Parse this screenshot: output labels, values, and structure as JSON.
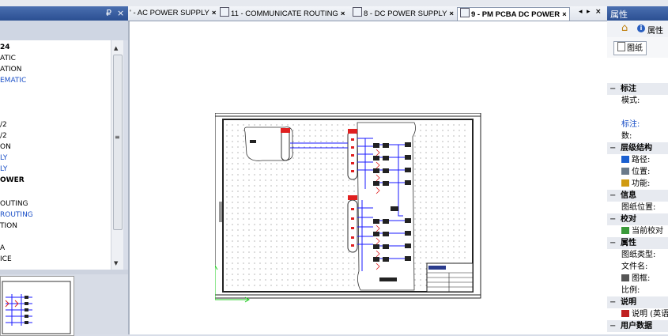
{
  "left_panel": {
    "pin": "₽",
    "close": "×",
    "tree_items": [
      {
        "text": "24",
        "style": "bold"
      },
      {
        "text": "ATIC",
        "style": "normal"
      },
      {
        "text": "ATION",
        "style": "normal"
      },
      {
        "text": "EMATIC",
        "style": "blue"
      },
      {
        "text": "/2",
        "style": "normal"
      },
      {
        "text": "/2",
        "style": "normal"
      },
      {
        "text": "ON",
        "style": "normal"
      },
      {
        "text": "LY",
        "style": "blue"
      },
      {
        "text": "LY",
        "style": "blue"
      },
      {
        "text": "OWER",
        "style": "bold"
      },
      {
        "text": "OUTING",
        "style": "normal"
      },
      {
        "text": " ROUTING",
        "style": "blue"
      },
      {
        "text": "TION",
        "style": "normal"
      },
      {
        "text": "A",
        "style": "normal"
      },
      {
        "text": "ICE",
        "style": "normal"
      }
    ]
  },
  "tabs": [
    {
      "label": "' - AC POWER SUPPLY",
      "icon": false,
      "active": false
    },
    {
      "label": "11 - COMMUNICATE ROUTING",
      "icon": true,
      "active": false
    },
    {
      "label": "8 - DC POWER SUPPLY",
      "icon": true,
      "active": false
    },
    {
      "label": "9 - PM PCBA DC POWER",
      "icon": true,
      "active": true
    }
  ],
  "tab_close": "×",
  "tab_nav": {
    "prev": "◂",
    "next": "▸",
    "close": "×"
  },
  "right_panel": {
    "title": "属性",
    "toolbar_label": "属性",
    "paper_tab": "图纸",
    "props": [
      {
        "type": "cat",
        "text": "标注"
      },
      {
        "type": "prop",
        "text": "模式:"
      },
      {
        "type": "blank"
      },
      {
        "type": "prop",
        "text": "标注:",
        "color": "blue"
      },
      {
        "type": "prop",
        "text": "数:"
      },
      {
        "type": "cat",
        "text": "层级结构"
      },
      {
        "type": "prop",
        "text": "路径:",
        "icon": "path-icon"
      },
      {
        "type": "prop",
        "text": "位置:",
        "icon": "location-icon"
      },
      {
        "type": "prop",
        "text": "功能:",
        "icon": "function-icon"
      },
      {
        "type": "cat",
        "text": "信息"
      },
      {
        "type": "prop",
        "text": "图纸位置:"
      },
      {
        "type": "cat",
        "text": "校对"
      },
      {
        "type": "prop",
        "text": "当前校对",
        "icon": "check-icon"
      },
      {
        "type": "cat",
        "text": "属性"
      },
      {
        "type": "prop",
        "text": "图纸类型:"
      },
      {
        "type": "prop",
        "text": "文件名:"
      },
      {
        "type": "prop",
        "text": "图框:",
        "icon": "frame-icon"
      },
      {
        "type": "prop",
        "text": "比例:"
      },
      {
        "type": "cat",
        "text": "说明"
      },
      {
        "type": "prop",
        "text": "说明 (英语",
        "icon": "flag-icon"
      },
      {
        "type": "cat",
        "text": "用户数据"
      }
    ]
  },
  "colors": {
    "header_blue": "#2b4f92",
    "wire_blue": "#1a1aff",
    "connector_red": "#e02020",
    "link_blue": "#1a4fc7"
  }
}
